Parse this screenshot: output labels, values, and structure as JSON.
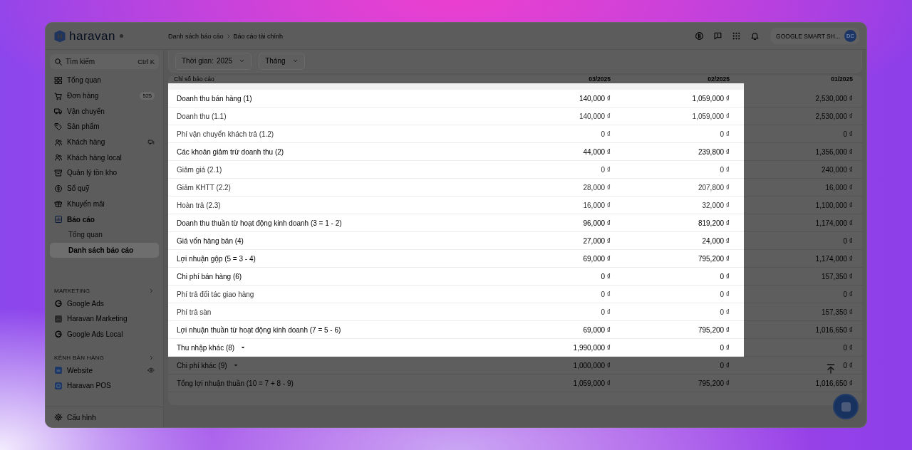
{
  "header": {
    "logo": "haravan",
    "breadcrumb": [
      "Danh sách báo cáo",
      "Báo cáo tài chính"
    ],
    "account": {
      "name": "GOOGLE SMART SH...",
      "initials": "DC"
    }
  },
  "sidebar": {
    "search": {
      "placeholder": "Tìm kiếm",
      "shortcut": "Ctrl K"
    },
    "items": [
      {
        "label": "Tổng quan",
        "selected": false
      },
      {
        "label": "Đơn hàng",
        "selected": false,
        "badge": "525"
      },
      {
        "label": "Vận chuyển",
        "selected": false
      },
      {
        "label": "Sản phẩm",
        "selected": false
      },
      {
        "label": "Khách hàng",
        "selected": false
      },
      {
        "label": "Khách hàng local",
        "selected": false
      },
      {
        "label": "Quản lý tồn kho",
        "selected": false
      },
      {
        "label": "Sổ quỹ",
        "selected": false
      },
      {
        "label": "Khuyến mãi",
        "selected": false
      },
      {
        "label": "Báo cáo",
        "selected": true,
        "children": [
          {
            "label": "Tổng quan",
            "selected": false
          },
          {
            "label": "Danh sách báo cáo",
            "selected": true
          }
        ]
      }
    ],
    "sections": [
      {
        "title": "MARKETING",
        "items": [
          {
            "label": "Google Ads"
          },
          {
            "label": "Haravan Marketing"
          },
          {
            "label": "Google Ads Local"
          }
        ]
      },
      {
        "title": "KÊNH BÁN HÀNG",
        "items": [
          {
            "label": "Website"
          },
          {
            "label": "Haravan POS"
          }
        ]
      }
    ],
    "footer": "Cấu hình"
  },
  "filters": [
    {
      "label": "Thời gian:",
      "value": "2025"
    },
    {
      "value": "Tháng"
    }
  ],
  "table": {
    "columns": [
      "Chỉ số báo cáo",
      "03/2025",
      "02/2025",
      "01/2025"
    ],
    "rows": [
      {
        "label": "Doanh thu bán hàng (1)",
        "values": [
          "140,000 ₫",
          "1,059,000 ₫",
          "2,530,000 ₫"
        ],
        "kind": "main",
        "expandable": false,
        "highlighted": true
      },
      {
        "label": "Doanh thu (1.1)",
        "values": [
          "140,000 ₫",
          "1,059,000 ₫",
          "2,530,000 ₫"
        ],
        "kind": "sub",
        "expandable": false,
        "highlighted": true
      },
      {
        "label": "Phí vận chuyển khách trả (1.2)",
        "values": [
          "0 ₫",
          "0 ₫",
          "0 ₫"
        ],
        "kind": "sub",
        "expandable": false,
        "highlighted": true
      },
      {
        "label": "Các khoản giảm trừ doanh thu (2)",
        "values": [
          "44,000 ₫",
          "239,800 ₫",
          "1,356,000 ₫"
        ],
        "kind": "main",
        "expandable": false,
        "highlighted": true
      },
      {
        "label": "Giảm giá (2.1)",
        "values": [
          "0 ₫",
          "0 ₫",
          "240,000 ₫"
        ],
        "kind": "sub",
        "expandable": false,
        "highlighted": true
      },
      {
        "label": "Giảm KHTT (2.2)",
        "values": [
          "28,000 ₫",
          "207,800 ₫",
          "16,000 ₫"
        ],
        "kind": "sub",
        "expandable": false,
        "highlighted": true
      },
      {
        "label": "Hoàn trả (2.3)",
        "values": [
          "16,000 ₫",
          "32,000 ₫",
          "1,100,000 ₫"
        ],
        "kind": "sub",
        "expandable": false,
        "highlighted": true
      },
      {
        "label": "Doanh thu thuần từ hoạt động kinh doanh (3 = 1 - 2)",
        "values": [
          "96,000 ₫",
          "819,200 ₫",
          "1,174,000 ₫"
        ],
        "kind": "main",
        "expandable": false,
        "highlighted": true
      },
      {
        "label": "Giá vốn hàng bán (4)",
        "values": [
          "27,000 ₫",
          "24,000 ₫",
          "0 ₫"
        ],
        "kind": "main",
        "expandable": false,
        "highlighted": true
      },
      {
        "label": "Lợi nhuận gộp (5 = 3 - 4)",
        "values": [
          "69,000 ₫",
          "795,200 ₫",
          "1,174,000 ₫"
        ],
        "kind": "main",
        "expandable": false,
        "highlighted": true
      },
      {
        "label": "Chi phí bán hàng (6)",
        "values": [
          "0 ₫",
          "0 ₫",
          "157,350 ₫"
        ],
        "kind": "main",
        "expandable": false,
        "highlighted": true
      },
      {
        "label": "Phí trả đối tác giao hàng",
        "values": [
          "0 ₫",
          "0 ₫",
          "0 ₫"
        ],
        "kind": "sub",
        "expandable": false,
        "highlighted": true
      },
      {
        "label": "Phí trả sàn",
        "values": [
          "0 ₫",
          "0 ₫",
          "157,350 ₫"
        ],
        "kind": "sub",
        "expandable": false,
        "highlighted": true
      },
      {
        "label": "Lợi nhuận thuần từ hoạt động kinh doanh (7 = 5 - 6)",
        "values": [
          "69,000 ₫",
          "795,200 ₫",
          "1,016,650 ₫"
        ],
        "kind": "main",
        "expandable": false,
        "highlighted": true
      },
      {
        "label": "Thu nhập khác (8)",
        "values": [
          "1,990,000 ₫",
          "0 ₫",
          "0 ₫"
        ],
        "kind": "main",
        "expandable": true,
        "highlighted": true
      },
      {
        "label": "Chi phí khác (9)",
        "values": [
          "1,000,000 ₫",
          "0 ₫",
          "0 ₫"
        ],
        "kind": "main",
        "expandable": true,
        "highlighted": false
      },
      {
        "label": "Tổng lợi nhuận thuần (10 = 7 + 8 - 9)",
        "values": [
          "1,059,000 ₫",
          "795,200 ₫",
          "1,016,650 ₫"
        ],
        "kind": "main",
        "expandable": false,
        "highlighted": false
      }
    ]
  }
}
